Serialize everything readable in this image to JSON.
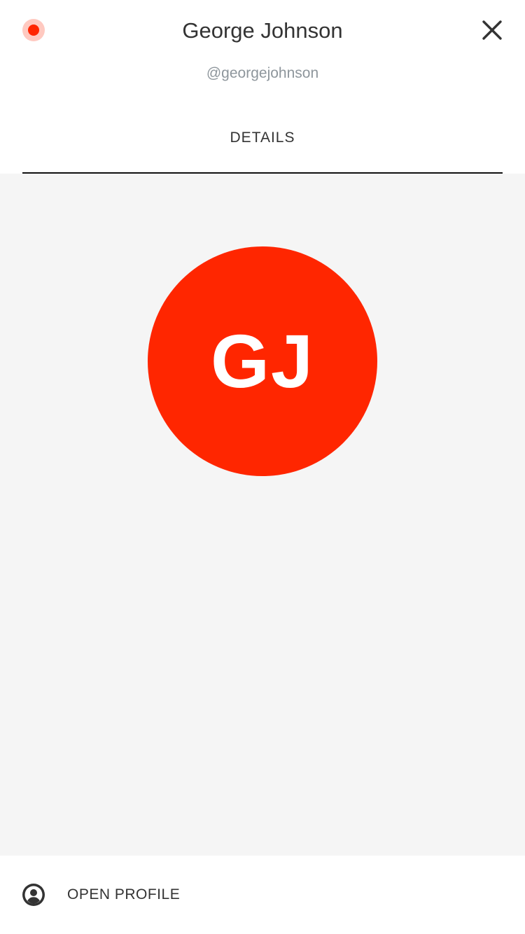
{
  "header": {
    "name": "George Johnson",
    "handle": "@georgejohnson",
    "status_icon": "status-dot",
    "status_color": "#ff2600",
    "close_icon": "close-icon"
  },
  "tabs": [
    {
      "label": "DETAILS",
      "active": true
    }
  ],
  "avatar": {
    "initials": "GJ",
    "color": "#ff2600"
  },
  "footer": {
    "open_profile_label": "OPEN PROFILE",
    "icon": "user-circle-icon"
  },
  "colors": {
    "accent": "#ff2600",
    "content_background": "#f5f5f5",
    "handle_text": "#8e969c"
  }
}
